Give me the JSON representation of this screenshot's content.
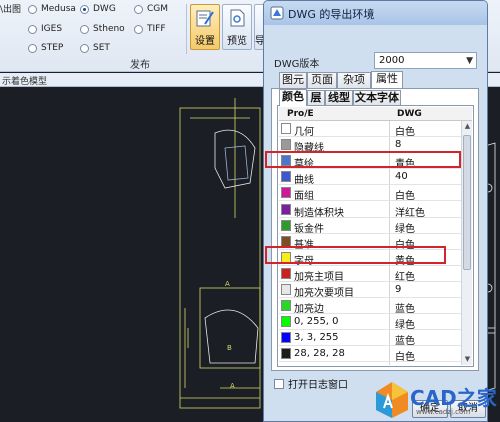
{
  "ribbon": {
    "left_fragment": "\\出图",
    "formats": [
      {
        "label": "Medusa",
        "selected": false
      },
      {
        "label": "DWG",
        "selected": true
      },
      {
        "label": "CGM",
        "selected": false
      },
      {
        "label": "IGES",
        "selected": false
      },
      {
        "label": "Stheno",
        "selected": false
      },
      {
        "label": "TIFF",
        "selected": false
      },
      {
        "label": "STEP",
        "selected": false
      },
      {
        "label": "SET",
        "selected": false
      }
    ],
    "settings_label": "设置",
    "preview_label": "预览",
    "export_label": "导",
    "group_label": "发布",
    "subbar_label": "示着色模型"
  },
  "dialog": {
    "title": "DWG 的导出环境",
    "version_label": "DWG版本",
    "version_value": "2000",
    "tabs_top": [
      "图元",
      "页面",
      "杂项",
      "属性"
    ],
    "tabs_sub": [
      "颜色",
      "层",
      "线型",
      "文本字体"
    ],
    "grid_headers": [
      "Pro/E",
      "DWG"
    ],
    "rows": [
      {
        "name": "几何",
        "value": "白色",
        "swatch": "#ffffff"
      },
      {
        "name": "隐藏线",
        "value": "8",
        "swatch": "#9a9a9a"
      },
      {
        "name": "草绘",
        "value": "青色",
        "swatch": "#4a77c9"
      },
      {
        "name": "曲线",
        "value": "40",
        "swatch": "#3f57cf"
      },
      {
        "name": "面组",
        "value": "白色",
        "swatch": "#d0179a"
      },
      {
        "name": "制造体积块",
        "value": "洋红色",
        "swatch": "#7a1f9e"
      },
      {
        "name": "钣金件",
        "value": "绿色",
        "swatch": "#2e9b2e"
      },
      {
        "name": "基准",
        "value": "白色",
        "swatch": "#7b4e27"
      },
      {
        "name": "字母",
        "value": "黄色",
        "swatch": "#f4ef1a"
      },
      {
        "name": "加亮主项目",
        "value": "红色",
        "swatch": "#c8231e"
      },
      {
        "name": "加亮次要项目",
        "value": "9",
        "swatch": "#e7e7e7"
      },
      {
        "name": "加亮边",
        "value": "蓝色",
        "swatch": "#27d827"
      },
      {
        "name": "0, 255, 0",
        "value": "绿色",
        "swatch": "#00ff00"
      },
      {
        "name": "3, 3, 255",
        "value": "蓝色",
        "swatch": "#0303ff"
      },
      {
        "name": "28, 28, 28",
        "value": "白色",
        "swatch": "#1c1c1c"
      }
    ],
    "log_checkbox_label": "打开日志窗口",
    "ok_label": "确定",
    "cancel_label": "取消"
  },
  "watermark": {
    "text": "CAD之家",
    "url": "www.cadzj.com"
  },
  "colors": {
    "highlight": "#d3242c",
    "title_bar": "#a9c4e7",
    "canvas": "#1b1e24"
  }
}
